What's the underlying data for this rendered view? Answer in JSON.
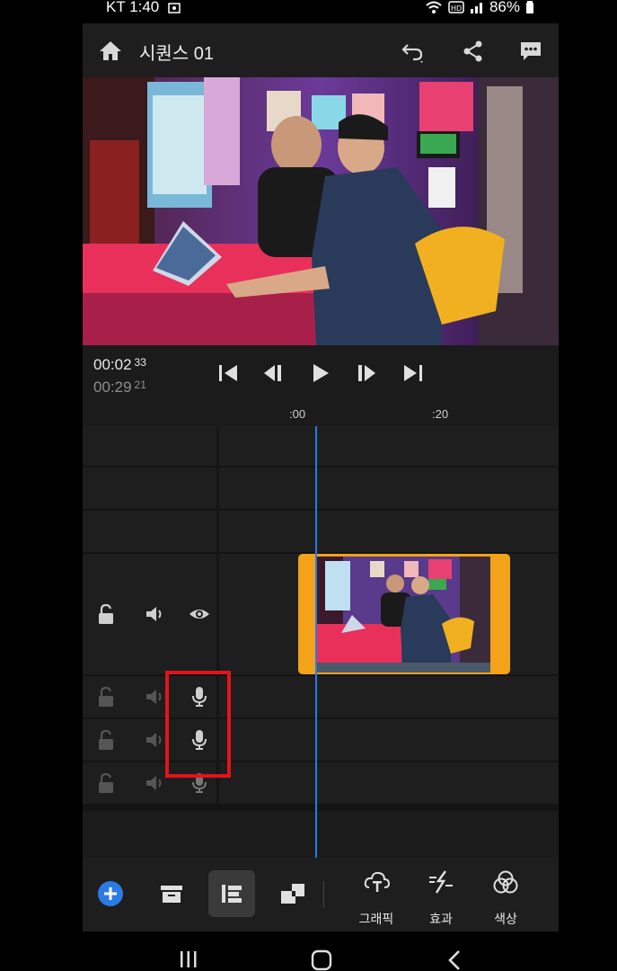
{
  "status": {
    "carrier_time": "KT 1:40",
    "battery": "86%"
  },
  "header": {
    "title": "시퀀스 01"
  },
  "transport": {
    "current_time": "00:02",
    "current_frames": "33",
    "total_time": "00:29",
    "total_frames": "21"
  },
  "ruler": {
    "marks": [
      ":00",
      ":20"
    ]
  },
  "bottom_bar": {
    "graphics_label": "그래픽",
    "effects_label": "효과",
    "color_label": "색상"
  },
  "colors": {
    "accent": "#2b7be4",
    "clip": "#f4a21a",
    "highlight": "#e3131b"
  }
}
